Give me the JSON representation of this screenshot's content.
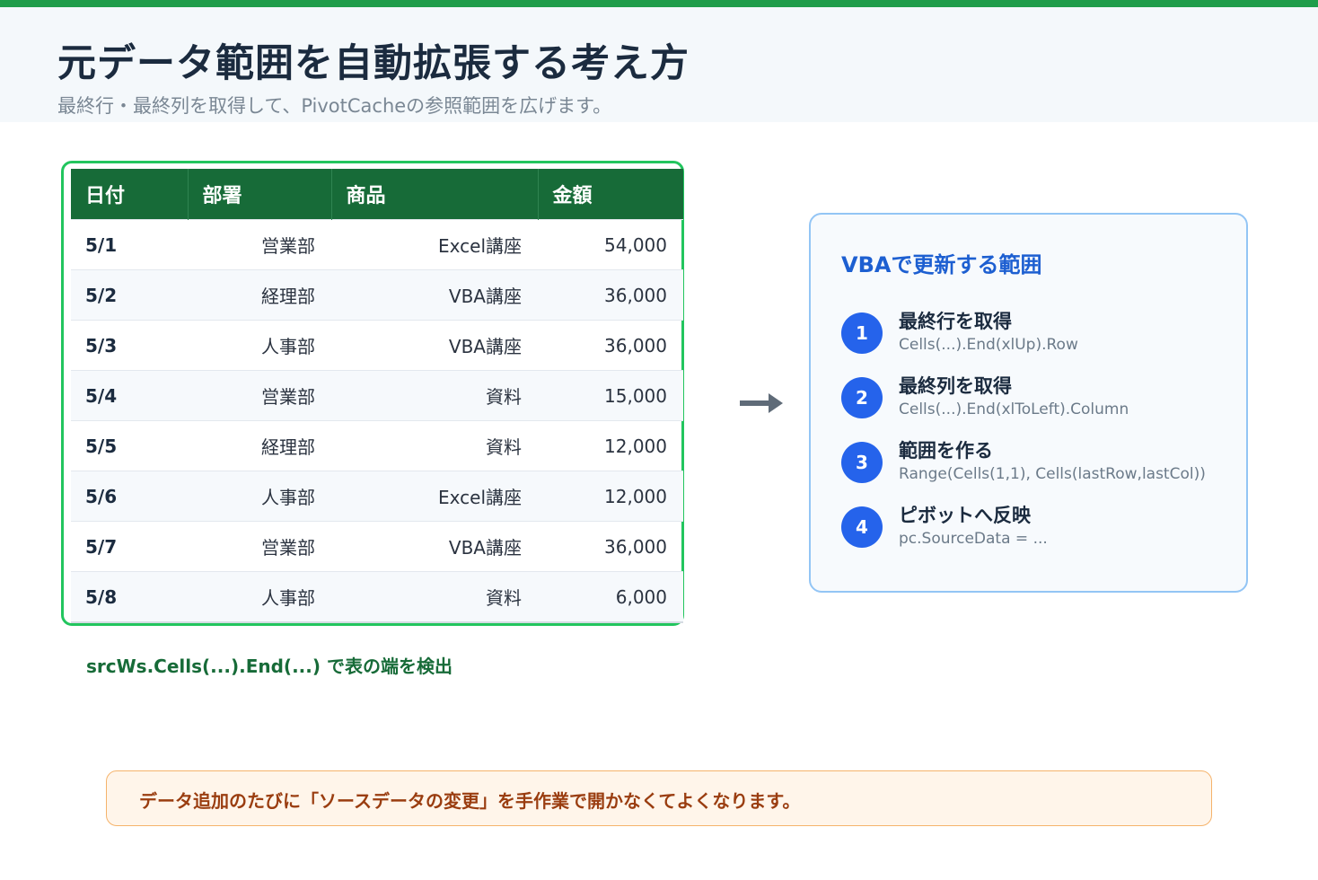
{
  "colors": {
    "accent_green": "#1f9d4a",
    "table_header": "#176b38",
    "highlight_border": "#22c55e",
    "panel_title_blue": "#1d5fd1",
    "step_circle_blue": "#2563eb",
    "note_text": "#9a3d10"
  },
  "header": {
    "title": "元データ範囲を自動拡張する考え方",
    "subtitle": "最終行・最終列を取得して、PivotCacheの参照範囲を広げます。"
  },
  "table": {
    "columns": [
      "日付",
      "部署",
      "商品",
      "金額"
    ],
    "rows": [
      [
        "5/1",
        "営業部",
        "Excel講座",
        "54,000"
      ],
      [
        "5/2",
        "経理部",
        "VBA講座",
        "36,000"
      ],
      [
        "5/3",
        "人事部",
        "VBA講座",
        "36,000"
      ],
      [
        "5/4",
        "営業部",
        "資料",
        "15,000"
      ],
      [
        "5/5",
        "経理部",
        "資料",
        "12,000"
      ],
      [
        "5/6",
        "人事部",
        "Excel講座",
        "12,000"
      ],
      [
        "5/7",
        "営業部",
        "VBA講座",
        "36,000"
      ],
      [
        "5/8",
        "人事部",
        "資料",
        "6,000"
      ]
    ],
    "caption": "srcWs.Cells(...).End(...) で表の端を検出"
  },
  "arrow_icon": "arrow-right-icon",
  "panel": {
    "title": "VBAで更新する範囲",
    "steps": [
      {
        "num": "1",
        "title": "最終行を取得",
        "code": "Cells(...).End(xlUp).Row"
      },
      {
        "num": "2",
        "title": "最終列を取得",
        "code": "Cells(...).End(xlToLeft).Column"
      },
      {
        "num": "3",
        "title": "範囲を作る",
        "code": "Range(Cells(1,1), Cells(lastRow,lastCol))"
      },
      {
        "num": "4",
        "title": "ピボットへ反映",
        "code": "pc.SourceData = ..."
      }
    ]
  },
  "note": "データ追加のたびに「ソースデータの変更」を手作業で開かなくてよくなります。"
}
